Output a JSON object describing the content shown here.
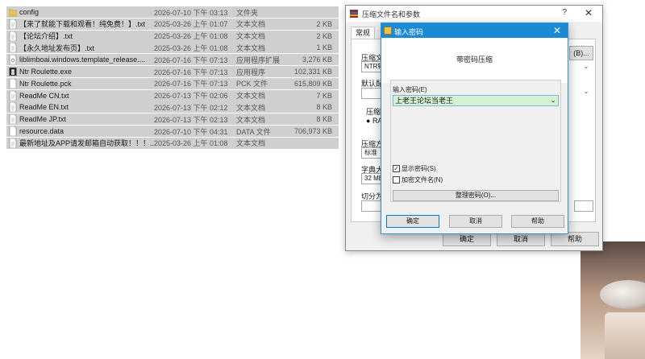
{
  "files": [
    {
      "icon": "folder-icon",
      "name": "config",
      "date": "2026-07-10 下午 03:13",
      "type": "文件夹",
      "size": ""
    },
    {
      "icon": "text-file-icon",
      "name": "【来了就能下载和观看！纯免费！】.txt",
      "date": "2025-03-26 上午 01:07",
      "type": "文本文档",
      "size": "2 KB"
    },
    {
      "icon": "text-file-icon",
      "name": "【论坛介绍】.txt",
      "date": "2025-03-26 上午 01:08",
      "type": "文本文档",
      "size": "2 KB"
    },
    {
      "icon": "text-file-icon",
      "name": "【永久地址发布页】.txt",
      "date": "2025-03-26 上午 01:08",
      "type": "文本文档",
      "size": "1 KB"
    },
    {
      "icon": "dll-file-icon",
      "name": "liblimboai.windows.template_release....",
      "date": "2026-07-16 下午 07:13",
      "type": "应用程序扩展",
      "size": "3,276 KB"
    },
    {
      "icon": "exe-file-icon",
      "name": "Ntr Roulette.exe",
      "date": "2026-07-16 下午 07:13",
      "type": "应用程序",
      "size": "102,331 KB"
    },
    {
      "icon": "blank-file-icon",
      "name": "Ntr Roulette.pck",
      "date": "2026-07-16 下午 07:13",
      "type": "PCK 文件",
      "size": "615,809 KB"
    },
    {
      "icon": "text-file-icon",
      "name": "ReadMe CN.txt",
      "date": "2026-07-13 下午 02:06",
      "type": "文本文档",
      "size": "7 KB"
    },
    {
      "icon": "text-file-icon",
      "name": "ReadMe EN.txt",
      "date": "2026-07-13 下午 02:12",
      "type": "文本文档",
      "size": "8 KB"
    },
    {
      "icon": "text-file-icon",
      "name": "ReadMe JP.txt",
      "date": "2026-07-13 下午 02:13",
      "type": "文本文档",
      "size": "8 KB"
    },
    {
      "icon": "blank-file-icon",
      "name": "resource.data",
      "date": "2026-07-10 下午 04:31",
      "type": "DATA 文件",
      "size": "706,973 KB"
    },
    {
      "icon": "text-file-icon",
      "name": "最新地址及APP请发邮箱自动获取！！！...",
      "date": "2025-03-26 上午 01:08",
      "type": "文本文档",
      "size": ""
    }
  ],
  "archive_dialog": {
    "title": "压缩文件名和参数",
    "help": "?",
    "close": "✕",
    "tab_general": "常规",
    "label_archive_name": "压缩文",
    "archive_name_value": "NTR轮",
    "browse_label": "(B)...",
    "label_default": "默认配",
    "label_format": "压缩",
    "format_rar": "RA",
    "label_method": "压缩方",
    "method_value": "标准",
    "label_dict": "字典大",
    "dict_value": "32 MB",
    "label_split": "切分为",
    "ok": "确定",
    "cancel": "取消",
    "help_button": "帮助"
  },
  "password_dialog": {
    "title": "输入密码",
    "close": "✕",
    "header": "带密码压缩",
    "enter_label": "输入密码(E)",
    "password_value": "上老王论坛当老王",
    "show_password_label": "显示密码(S)",
    "show_password_checked": true,
    "encrypt_names_label": "加密文件名(N)",
    "encrypt_names_checked": false,
    "organize_label": "整理密码(O)...",
    "ok": "确定",
    "cancel": "取消",
    "help": "帮助"
  },
  "colors": {
    "row_selected": "#cfcfcf",
    "pw_titlebar": "#1a8ad4",
    "pw_field_bg": "#d6f1d0"
  }
}
